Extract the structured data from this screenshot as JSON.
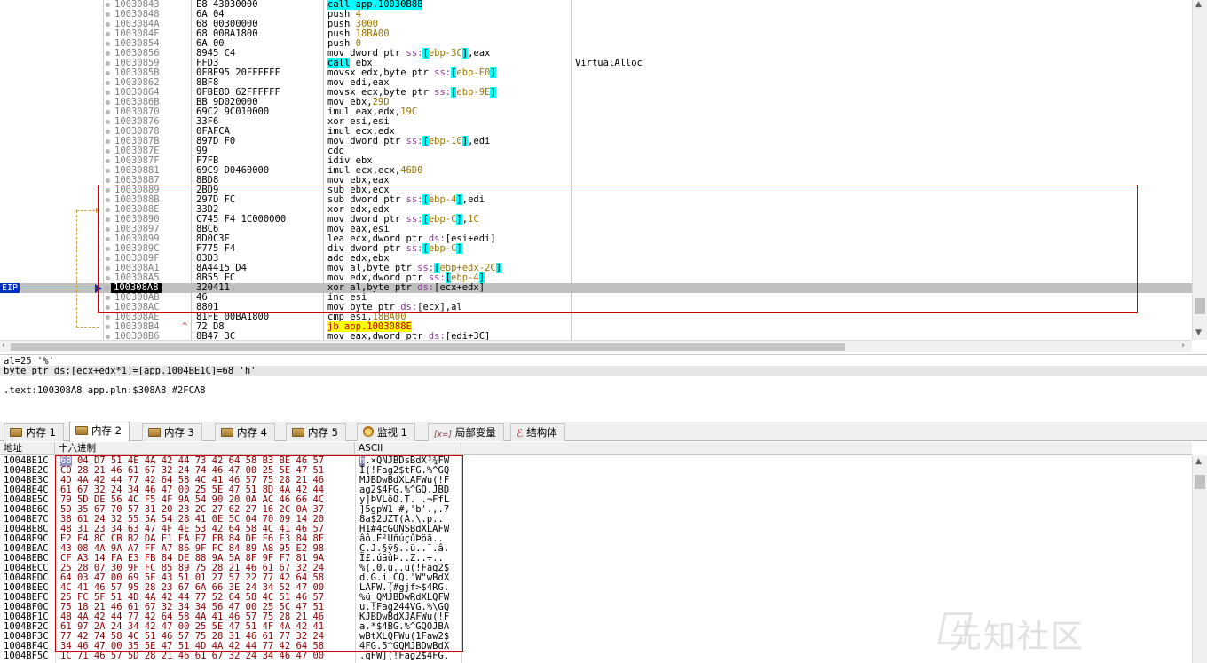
{
  "disasm": {
    "rows": [
      {
        "addr": "10030843",
        "bytes": "E8 43030000",
        "mn": "call",
        "ops": [
          {
            "t": "call app.10030B8B",
            "c": "call"
          }
        ]
      },
      {
        "addr": "10030848",
        "bytes": "6A 04",
        "mn": "push",
        "ops": [
          {
            "t": "4",
            "c": "imm"
          }
        ]
      },
      {
        "addr": "1003084A",
        "bytes": "68 00300000",
        "mn": "push",
        "ops": [
          {
            "t": "3000",
            "c": "imm"
          }
        ]
      },
      {
        "addr": "1003084F",
        "bytes": "68 00BA1800",
        "mn": "push",
        "ops": [
          {
            "t": "18BA00",
            "c": "imm"
          }
        ]
      },
      {
        "addr": "10030854",
        "bytes": "6A 00",
        "mn": "push",
        "ops": [
          {
            "t": "0",
            "c": "imm"
          }
        ]
      },
      {
        "addr": "10030856",
        "bytes": "8945 C4",
        "mn": "mov",
        "ops": [
          {
            "t": "dword ptr ",
            "c": ""
          },
          {
            "t": "ss:",
            "c": "seg"
          },
          {
            "t": "[",
            "c": "brk"
          },
          {
            "t": "ebp-3C",
            "c": "imm"
          },
          {
            "t": "]",
            "c": "brk"
          },
          {
            "t": ",eax",
            "c": ""
          }
        ]
      },
      {
        "addr": "10030859",
        "bytes": "FFD3",
        "mn": "call",
        "ops": [
          {
            "t": "call",
            "c": "call"
          },
          {
            "t": " ebx",
            "c": ""
          }
        ],
        "cmt": "VirtualAlloc"
      },
      {
        "addr": "1003085B",
        "bytes": "0FBE95 20FFFFFF",
        "mn": "movsx",
        "ops": [
          {
            "t": "edx,byte ptr ",
            "c": ""
          },
          {
            "t": "ss:",
            "c": "seg"
          },
          {
            "t": "[",
            "c": "brk"
          },
          {
            "t": "ebp-E0",
            "c": "imm"
          },
          {
            "t": "]",
            "c": "brk"
          }
        ]
      },
      {
        "addr": "10030862",
        "bytes": "8BF8",
        "mn": "mov",
        "ops": [
          {
            "t": "edi,eax",
            "c": ""
          }
        ]
      },
      {
        "addr": "10030864",
        "bytes": "0FBE8D 62FFFFFF",
        "mn": "movsx",
        "ops": [
          {
            "t": "ecx,byte ptr ",
            "c": ""
          },
          {
            "t": "ss:",
            "c": "seg"
          },
          {
            "t": "[",
            "c": "brk"
          },
          {
            "t": "ebp-9E",
            "c": "imm"
          },
          {
            "t": "]",
            "c": "brk"
          }
        ]
      },
      {
        "addr": "1003086B",
        "bytes": "BB 9D020000",
        "mn": "mov",
        "ops": [
          {
            "t": "ebx,",
            "c": ""
          },
          {
            "t": "29D",
            "c": "imm"
          }
        ]
      },
      {
        "addr": "10030870",
        "bytes": "69C2 9C010000",
        "mn": "imul",
        "ops": [
          {
            "t": "eax,edx,",
            "c": ""
          },
          {
            "t": "19C",
            "c": "imm"
          }
        ]
      },
      {
        "addr": "10030876",
        "bytes": "33F6",
        "mn": "xor",
        "ops": [
          {
            "t": "esi,esi",
            "c": ""
          }
        ]
      },
      {
        "addr": "10030878",
        "bytes": "0FAFCA",
        "mn": "imul",
        "ops": [
          {
            "t": "ecx,edx",
            "c": ""
          }
        ]
      },
      {
        "addr": "1003087B",
        "bytes": "897D F0",
        "mn": "mov",
        "ops": [
          {
            "t": "dword ptr ",
            "c": ""
          },
          {
            "t": "ss:",
            "c": "seg"
          },
          {
            "t": "[",
            "c": "brk"
          },
          {
            "t": "ebp-10",
            "c": "imm"
          },
          {
            "t": "]",
            "c": "brk"
          },
          {
            "t": ",edi",
            "c": ""
          }
        ]
      },
      {
        "addr": "1003087E",
        "bytes": "99",
        "mn": "cdq",
        "ops": []
      },
      {
        "addr": "1003087F",
        "bytes": "F7FB",
        "mn": "idiv",
        "ops": [
          {
            "t": "ebx",
            "c": ""
          }
        ]
      },
      {
        "addr": "10030881",
        "bytes": "69C9 D0460000",
        "mn": "imul",
        "ops": [
          {
            "t": "ecx,ecx,",
            "c": ""
          },
          {
            "t": "46D0",
            "c": "imm"
          }
        ]
      },
      {
        "addr": "10030887",
        "bytes": "8BD8",
        "mn": "mov",
        "ops": [
          {
            "t": "ebx,eax",
            "c": ""
          }
        ]
      },
      {
        "addr": "10030889",
        "bytes": "2BD9",
        "mn": "sub",
        "ops": [
          {
            "t": "ebx,ecx",
            "c": ""
          }
        ]
      },
      {
        "addr": "1003088B",
        "bytes": "297D FC",
        "mn": "sub",
        "ops": [
          {
            "t": "dword ptr ",
            "c": ""
          },
          {
            "t": "ss:",
            "c": "seg"
          },
          {
            "t": "[",
            "c": "brk"
          },
          {
            "t": "ebp-4",
            "c": "imm"
          },
          {
            "t": "]",
            "c": "brk"
          },
          {
            "t": ",edi",
            "c": ""
          }
        ]
      },
      {
        "addr": "1003088E",
        "bytes": "33D2",
        "mn": "xor",
        "ops": [
          {
            "t": "edx,edx",
            "c": ""
          }
        ]
      },
      {
        "addr": "10030890",
        "bytes": "C745 F4 1C000000",
        "mn": "mov",
        "ops": [
          {
            "t": "dword ptr ",
            "c": ""
          },
          {
            "t": "ss:",
            "c": "seg"
          },
          {
            "t": "[",
            "c": "brk"
          },
          {
            "t": "ebp-C",
            "c": "imm"
          },
          {
            "t": "]",
            "c": "brk"
          },
          {
            "t": ",",
            "c": ""
          },
          {
            "t": "1C",
            "c": "imm"
          }
        ]
      },
      {
        "addr": "10030897",
        "bytes": "8BC6",
        "mn": "mov",
        "ops": [
          {
            "t": "eax,esi",
            "c": ""
          }
        ]
      },
      {
        "addr": "10030899",
        "bytes": "8D0C3E",
        "mn": "lea",
        "ops": [
          {
            "t": "ecx,dword ptr ",
            "c": ""
          },
          {
            "t": "ds:",
            "c": "seg"
          },
          {
            "t": "[esi+edi]",
            "c": ""
          }
        ]
      },
      {
        "addr": "1003089C",
        "bytes": "F775 F4",
        "mn": "div",
        "ops": [
          {
            "t": "dword ptr ",
            "c": ""
          },
          {
            "t": "ss:",
            "c": "seg"
          },
          {
            "t": "[",
            "c": "brk"
          },
          {
            "t": "ebp-C",
            "c": "imm"
          },
          {
            "t": "]",
            "c": "brk"
          }
        ]
      },
      {
        "addr": "1003089F",
        "bytes": "03D3",
        "mn": "add",
        "ops": [
          {
            "t": "edx,ebx",
            "c": ""
          }
        ]
      },
      {
        "addr": "100308A1",
        "bytes": "8A4415 D4",
        "mn": "mov",
        "ops": [
          {
            "t": "al,byte ptr ",
            "c": ""
          },
          {
            "t": "ss:",
            "c": "seg"
          },
          {
            "t": "[",
            "c": "brk"
          },
          {
            "t": "ebp+edx-2C",
            "c": "imm"
          },
          {
            "t": "]",
            "c": "brk"
          }
        ]
      },
      {
        "addr": "100308A5",
        "bytes": "8B55 FC",
        "mn": "mov",
        "ops": [
          {
            "t": "edx,dword ptr ",
            "c": ""
          },
          {
            "t": "ss:",
            "c": "seg"
          },
          {
            "t": "[",
            "c": "brk"
          },
          {
            "t": "ebp-4",
            "c": "imm"
          },
          {
            "t": "]",
            "c": "brk"
          }
        ]
      },
      {
        "addr": "100308A8",
        "bytes": "320411",
        "mn": "xor",
        "ops": [
          {
            "t": "al,byte ptr ",
            "c": ""
          },
          {
            "t": "ds:",
            "c": "seg"
          },
          {
            "t": "[ecx+edx]",
            "c": ""
          }
        ],
        "current": true
      },
      {
        "addr": "100308AB",
        "bytes": "46",
        "mn": "inc",
        "ops": [
          {
            "t": "esi",
            "c": ""
          }
        ]
      },
      {
        "addr": "100308AC",
        "bytes": "8801",
        "mn": "mov",
        "ops": [
          {
            "t": "byte ptr ",
            "c": ""
          },
          {
            "t": "ds:",
            "c": "seg"
          },
          {
            "t": "[ecx],al",
            "c": ""
          }
        ]
      },
      {
        "addr": "100308AE",
        "bytes": "81FE 00BA1800",
        "mn": "cmp",
        "ops": [
          {
            "t": "esi,",
            "c": ""
          },
          {
            "t": "18BA00",
            "c": "imm"
          }
        ]
      },
      {
        "addr": "100308B4",
        "bytes": "72 D8",
        "mn": "jb",
        "ops": [
          {
            "t": "jb",
            "c": "jb"
          },
          {
            "t": " app.1003088E",
            "c": "jb"
          }
        ],
        "arrow": "^"
      },
      {
        "addr": "100308B6",
        "bytes": "8B47 3C",
        "mn": "mov",
        "ops": [
          {
            "t": "eax,dword ptr ",
            "c": ""
          },
          {
            "t": "ds:",
            "c": "seg"
          },
          {
            "t": "[edi+3C]",
            "c": ""
          }
        ]
      }
    ],
    "eip_label": "EIP"
  },
  "info": {
    "line1": "al=25 '%'",
    "line2": "byte ptr ds:[ecx+edx*1]=[app.1004BE1C]=68 'h'",
    "line3": ".text:100308A8 app.pln:$308A8 #2FCA8"
  },
  "tabs": [
    {
      "label": "内存 1",
      "icon": "memory-icon"
    },
    {
      "label": "内存 2",
      "icon": "memory-icon",
      "active": true
    },
    {
      "label": "内存 3",
      "icon": "memory-icon"
    },
    {
      "label": "内存 4",
      "icon": "memory-icon"
    },
    {
      "label": "内存 5",
      "icon": "memory-icon"
    },
    {
      "label": "监视 1",
      "icon": "watch-icon"
    },
    {
      "label": "局部变量",
      "icon": "local-vars-icon",
      "icon_text": "[x=]"
    },
    {
      "label": "结构体",
      "icon": "struct-icon",
      "icon_text": "ℰ"
    }
  ],
  "dump": {
    "headers": {
      "addr": "地址",
      "hex": "十六进制",
      "ascii": "ASCII"
    },
    "rows": [
      {
        "addr": "1004BE1C",
        "hex": "68 04 D7 51 4E 4A 42 44 73 42 64 58 B3 BE 46 57",
        "ascii": "h.×QNJBDsBdX³¾FW"
      },
      {
        "addr": "1004BE2C",
        "hex": "CD 28 21 46 61 67 32 24 74 46 47 00 25 5E 47 51",
        "ascii": "Í(!Fag2$tFG.%^GQ"
      },
      {
        "addr": "1004BE3C",
        "hex": "4D 4A 42 44 77 42 64 58 4C 41 46 57 75 28 21 46",
        "ascii": "MJBDwBdXLAFWu(!F"
      },
      {
        "addr": "1004BE4C",
        "hex": "61 67 32 24 34 46 47 00 25 5E 47 51 8D 4A 42 44",
        "ascii": "ag2$4FG.%^GQ.JBD"
      },
      {
        "addr": "1004BE5C",
        "hex": "79 5D DE 56 4C F5 4F 9A 54 90 20 0A AC 46 66 4C",
        "ascii": "y]ÞVLõO.T. .¬FfL"
      },
      {
        "addr": "1004BE6C",
        "hex": "5D 35 67 70 57 31 20 23 2C 27 62 27 16 2C 0A 37",
        "ascii": "]5gpW1 #,'b'.,.7"
      },
      {
        "addr": "1004BE7C",
        "hex": "38 61 24 32 55 5A 54 28 41 0E 5C 04 70 09 14 20",
        "ascii": "8a$2UZT(A.\\.p.. "
      },
      {
        "addr": "1004BE8C",
        "hex": "48 31 23 34 63 47 4F 4E 53 42 64 58 4C 41 46 57",
        "ascii": "H1#4cGONSBdXLAFW"
      },
      {
        "addr": "1004BE9C",
        "hex": "E2 F4 8C CB B2 DA F1 FA E7 FB 84 DE F6 E3 84 8F",
        "ascii": "âô.Ë²ÚñúçûÞöã.."
      },
      {
        "addr": "1004BEAC",
        "hex": "43 08 4A 9A A7 FF A7 86 9F FC 84 89 A8 95 E2 98",
        "ascii": "C.J.§ÿ§..ü..¨.â."
      },
      {
        "addr": "1004BEBC",
        "hex": "CF A3 14 FA E3 FB 84 DE 88 9A 5A 8F 9F F7 81 9A",
        "ascii": "Ï£.úãûÞ..Z..÷.."
      },
      {
        "addr": "1004BECC",
        "hex": "25 28 07 30 9F FC 85 89 75 28 21 46 61 67 32 24",
        "ascii": "%(.0.ü..u(!Fag2$"
      },
      {
        "addr": "1004BEDC",
        "hex": "64 03 47 00 69 5F 43 51 01 27 57 22 77 42 64 58",
        "ascii": "d.G.i_CQ.'W\"wBdX"
      },
      {
        "addr": "1004BEEC",
        "hex": "4C 41 46 57 95 28 23 67 6A 66 3E 24 34 52 47 00",
        "ascii": "LAFW.(#gjf>$4RG."
      },
      {
        "addr": "1004BEFC",
        "hex": "25 FC 5F 51 4D 4A 42 44 77 52 64 58 4C 51 46 57",
        "ascii": "%ü_QMJBDwRdXLQFW"
      },
      {
        "addr": "1004BF0C",
        "hex": "75 18 21 46 61 67 32 34 34 56 47 00 25 5C 47 51",
        "ascii": "u.!Fag244VG.%\\GQ"
      },
      {
        "addr": "1004BF1C",
        "hex": "4B 4A 42 44 77 42 64 58 4A 41 46 57 75 28 21 46",
        "ascii": "KJBDwBdXJAFWu(!F"
      },
      {
        "addr": "1004BF2C",
        "hex": "61 97 2A 24 34 42 47 00 25 5E 47 51 4F 4A 42 41",
        "ascii": "a.*$4BG.%^GQOJBA"
      },
      {
        "addr": "1004BF3C",
        "hex": "77 42 74 58 4C 51 46 57 75 28 31 46 61 77 32 24",
        "ascii": "wBtXLQFWu(1Faw2$"
      },
      {
        "addr": "1004BF4C",
        "hex": "34 46 47 00 35 5E 47 51 4D 4A 42 44 77 42 64 58",
        "ascii": "4FG.5^GQMJBDwBdX"
      },
      {
        "addr": "1004BF5C",
        "hex": "1C 71 46 57 5D 28 21 46 61 67 32 24 34 46 47 00",
        "ascii": ".qFW](!Fag2$4FG."
      }
    ]
  },
  "watermark": "先知社区"
}
